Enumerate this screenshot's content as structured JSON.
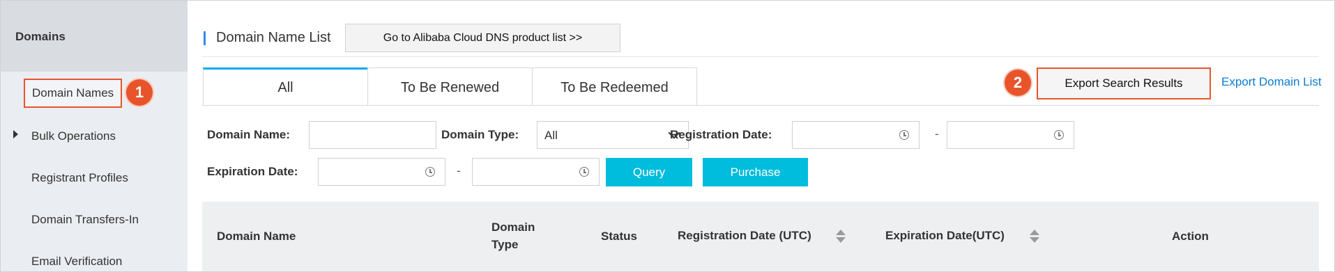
{
  "sidebar": {
    "title": "Domains",
    "items": [
      {
        "label": "Domain Names"
      },
      {
        "label": "Bulk Operations"
      },
      {
        "label": "Registrant Profiles"
      },
      {
        "label": "Domain Transfers-In"
      },
      {
        "label": "Email Verification"
      }
    ]
  },
  "callouts": {
    "first": "1",
    "second": "2"
  },
  "header": {
    "title": "Domain Name List",
    "goto_button": "Go to Alibaba Cloud DNS product list >>"
  },
  "tabs": [
    {
      "label": "All"
    },
    {
      "label": "To Be Renewed"
    },
    {
      "label": "To Be Redeemed"
    }
  ],
  "actions": {
    "export_search": "Export Search Results",
    "export_list": "Export Domain List"
  },
  "filters": {
    "domain_name_label": "Domain Name:",
    "domain_name_value": "",
    "domain_type_label": "Domain Type:",
    "domain_type_value": "All",
    "registration_date_label": "Registration Date:",
    "expiration_date_label": "Expiration Date:",
    "range_separator": "-",
    "query_button": "Query",
    "purchase_button": "Purchase"
  },
  "table": {
    "columns": [
      {
        "label": "Domain Name"
      },
      {
        "label": "Domain Type"
      },
      {
        "label": "Status"
      },
      {
        "label": "Registration Date (UTC)"
      },
      {
        "label": "Expiration Date(UTC)"
      },
      {
        "label": "Action"
      }
    ]
  },
  "colors": {
    "accent": "#00bcdd",
    "highlight": "#e8542a",
    "link": "#0a7bd1",
    "tab_active": "#00aaee"
  }
}
